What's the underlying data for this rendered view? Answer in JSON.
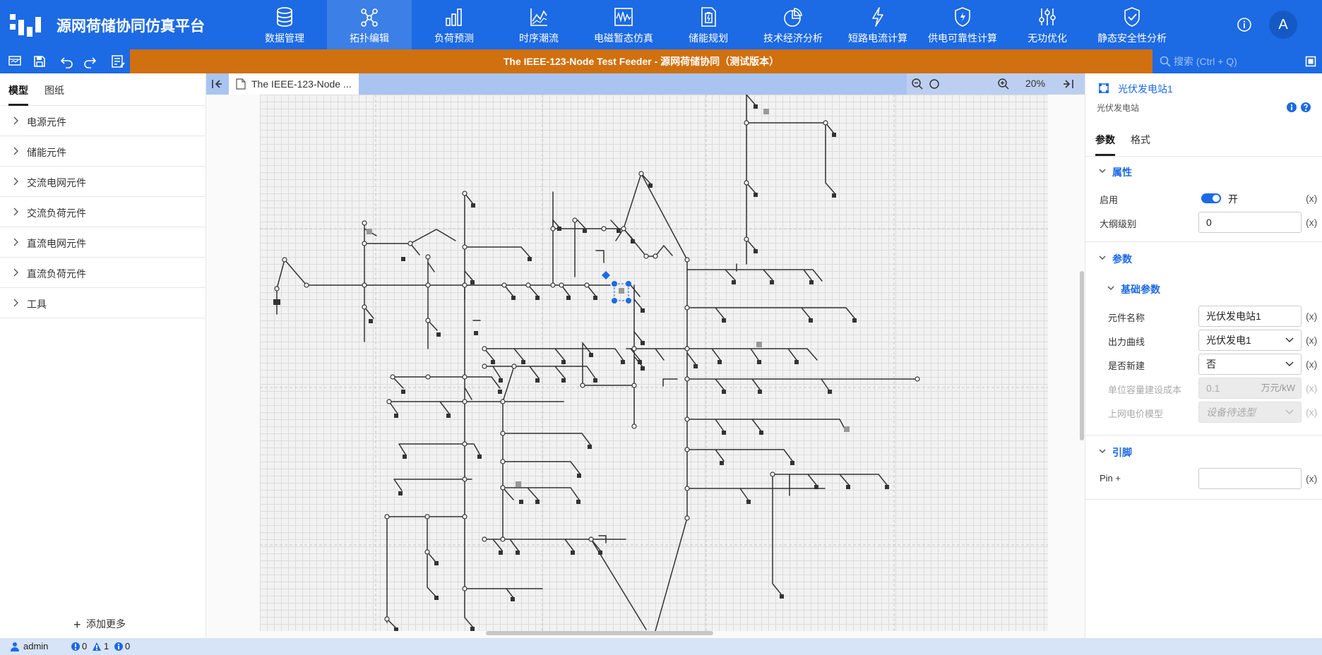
{
  "app": {
    "title": "源网荷储协同仿真平台",
    "avatar_letter": "A"
  },
  "colors": {
    "brand_blue": "#1c6ae4",
    "title_bar_orange": "#d0700f",
    "status_bar": "#d7e3f7"
  },
  "nav": {
    "active": "拓扑编辑",
    "items": [
      {
        "label": "数据管理",
        "icon": "database-icon"
      },
      {
        "label": "拓扑编辑",
        "icon": "topology-icon"
      },
      {
        "label": "负荷预测",
        "icon": "bar-chart-icon"
      },
      {
        "label": "时序潮流",
        "icon": "line-chart-icon"
      },
      {
        "label": "电磁暂态仿真",
        "icon": "waveform-icon"
      },
      {
        "label": "储能规划",
        "icon": "battery-document-icon"
      },
      {
        "label": "技术经济分析",
        "icon": "pie-chart-icon"
      },
      {
        "label": "短路电流计算",
        "icon": "lightning-icon"
      },
      {
        "label": "供电可靠性计算",
        "icon": "shield-bolt-icon"
      },
      {
        "label": "无功优化",
        "icon": "sliders-icon"
      },
      {
        "label": "静态安全性分析",
        "icon": "shield-check-icon"
      }
    ]
  },
  "toolbar": {
    "doc_title": "The IEEE-123-Node Test Feeder - 源网荷储协同（测试版本）",
    "search_placeholder": "搜索 (Ctrl + Q)"
  },
  "left_panel": {
    "tabs": [
      "模型",
      "图纸"
    ],
    "active_tab": "模型",
    "categories": [
      "电源元件",
      "储能元件",
      "交流电网元件",
      "交流负荷元件",
      "直流电网元件",
      "直流负荷元件",
      "工具"
    ],
    "add_more": "添加更多"
  },
  "canvas": {
    "tab_label": "The IEEE-123-Node ...",
    "zoom": "20%"
  },
  "right_panel": {
    "title": "光伏发电站1",
    "subtitle": "光伏发电站",
    "tabs": [
      "参数",
      "格式"
    ],
    "active_tab": "参数",
    "section_attributes": "属性",
    "enabled_label": "启用",
    "enabled_value": "开",
    "outline_label": "大纲级别",
    "outline_value": "0",
    "section_params": "参数",
    "subsection_basic": "基础参数",
    "name_label": "元件名称",
    "name_value": "光伏发电站1",
    "curve_label": "出力曲线",
    "curve_value": "光伏发电1",
    "new_build_label": "是否新建",
    "new_build_value": "否",
    "unit_cost_label": "单位容量建设成本",
    "unit_cost_value": "0.1",
    "unit_cost_unit": "万元/kW",
    "price_model_label": "上网电价模型",
    "price_model_value": "设备待选型",
    "section_pins": "引脚",
    "pin_label": "Pin +",
    "pin_value": "",
    "reset_mark": "(x)"
  },
  "status": {
    "user": "admin",
    "errors": "0",
    "warnings": "1",
    "infos": "0"
  }
}
